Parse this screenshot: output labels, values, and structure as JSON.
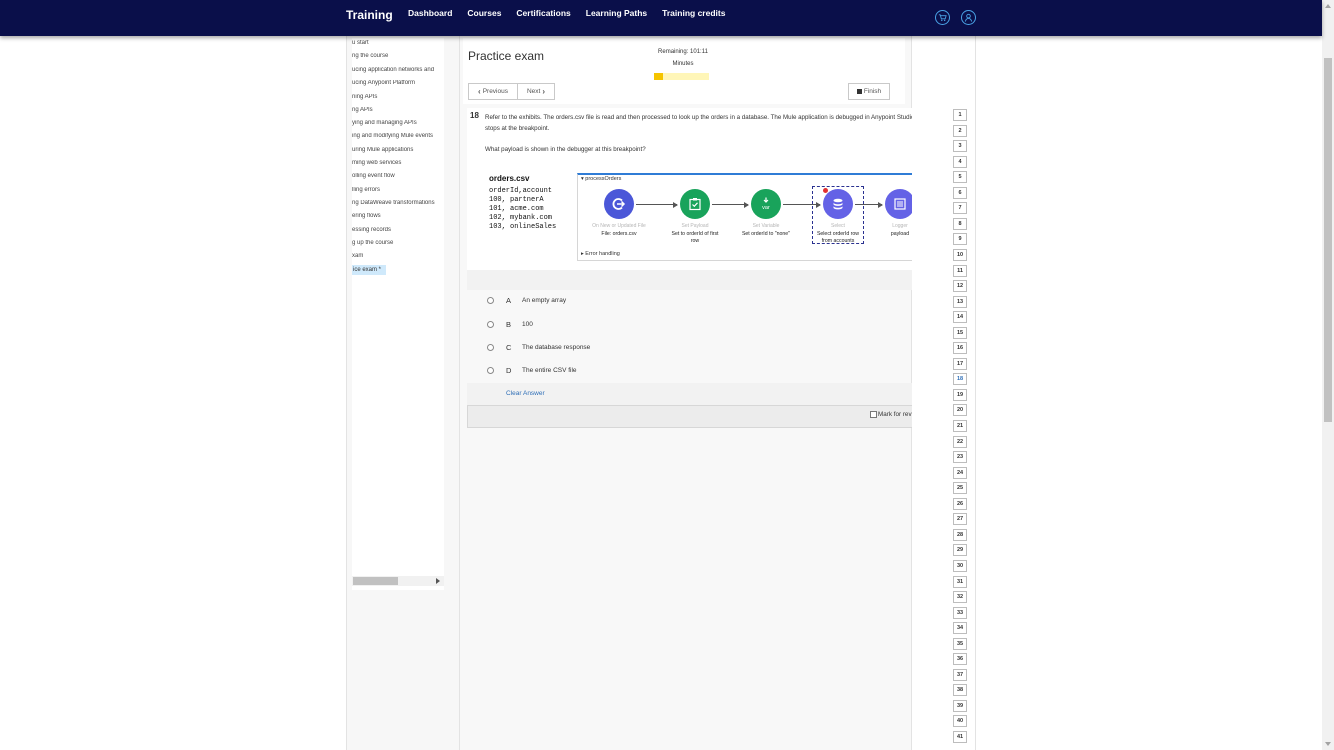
{
  "nav": {
    "brand": "Training",
    "links": [
      "Dashboard",
      "Courses",
      "Certifications",
      "Learning Paths",
      "Training credits"
    ]
  },
  "sidebar": {
    "items": [
      "u start",
      "ng the course",
      "ucing application networks and",
      "ucing Anypoint Platform",
      "ning APIs",
      "ng APIs",
      "ying and managing APIs",
      "ing and modifying Mule events",
      "uring Mule applications",
      "ming web services",
      "olling event flow",
      "lling errors",
      "ng DataWeave transformations",
      "ering flows",
      "essing records",
      "g up the course",
      "xam",
      "ice exam *"
    ]
  },
  "exam": {
    "title": "Practice exam",
    "remaining": "Remaining: 101:11",
    "remaining_unit": "Minutes",
    "progress_fraction": 0.16,
    "previous_label": "Previous",
    "next_label": "Next",
    "finish_label": "Finish"
  },
  "question": {
    "number": "18",
    "text": "Refer to the exhibits. The orders.csv file is read and then processed to look up the orders in a database. The Mule application is debugged in Anypoint Studio and stops at the breakpoint.",
    "prompt": "What payload is shown in the debugger at this breakpoint?",
    "csv": {
      "title": "orders.csv",
      "lines": [
        "orderId,account",
        "100, partnerA",
        "101, acme.com",
        "102, mybank.com",
        "103, onlineSales"
      ]
    },
    "flow": {
      "name": "processOrders",
      "error_handling": "Error handling",
      "nodes": [
        {
          "type": "On New or Updated File",
          "caption": "File: orders.csv",
          "color": "#4b57d8"
        },
        {
          "type": "Set Payload",
          "caption": "Set to orderId of first row",
          "color": "#19a35b"
        },
        {
          "type": "Set Variable",
          "caption": "Set orderId to \"none\"",
          "color": "#19a35b"
        },
        {
          "type": "Select",
          "caption": "Select orderId row from accounts",
          "color": "#6462e6"
        },
        {
          "type": "Logger",
          "caption": "payload",
          "color": "#6462e6"
        }
      ]
    },
    "options": [
      {
        "letter": "A",
        "text": "An empty array"
      },
      {
        "letter": "B",
        "text": "100"
      },
      {
        "letter": "C",
        "text": "The database response"
      },
      {
        "letter": "D",
        "text": "The entire CSV file"
      }
    ],
    "clear_label": "Clear Answer",
    "review_label": "Mark for review"
  },
  "question_nav": {
    "numbers": [
      "1",
      "2",
      "3",
      "4",
      "5",
      "6",
      "7",
      "8",
      "9",
      "10",
      "11",
      "12",
      "13",
      "14",
      "15",
      "16",
      "17",
      "18",
      "19",
      "20",
      "21",
      "22",
      "23",
      "24",
      "25",
      "26",
      "27",
      "28",
      "29",
      "30",
      "31",
      "32",
      "33",
      "34",
      "35",
      "36",
      "37",
      "38",
      "39",
      "40",
      "41"
    ],
    "current": "18"
  }
}
